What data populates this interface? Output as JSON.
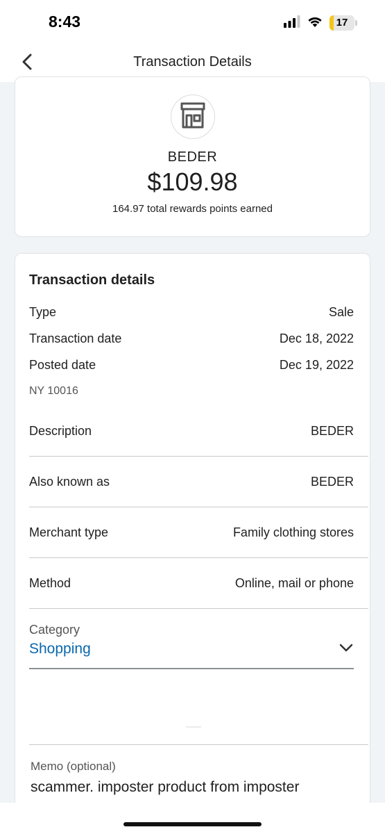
{
  "status_bar": {
    "time": "8:43",
    "battery_level": "17",
    "battery_fraction": 0.17,
    "battery_color": "#f5c518"
  },
  "nav": {
    "title": "Transaction Details",
    "back_icon": "chevron-left-icon"
  },
  "summary": {
    "merchant_icon": "storefront-icon",
    "merchant_name": "BEDER",
    "amount": "$109.98",
    "rewards": "164.97 total rewards points earned"
  },
  "details": {
    "title": "Transaction details",
    "type_label": "Type",
    "type_value": "Sale",
    "transaction_date_label": "Transaction date",
    "transaction_date_value": "Dec 18, 2022",
    "posted_date_label": "Posted date",
    "posted_date_value": "Dec 19, 2022",
    "location": "NY 10016",
    "description_label": "Description",
    "description_value": "BEDER",
    "aka_label": "Also known as",
    "aka_value": "BEDER",
    "merchant_type_label": "Merchant type",
    "merchant_type_value": "Family clothing stores",
    "method_label": "Method",
    "method_value": "Online, mail or phone"
  },
  "category": {
    "label": "Category",
    "value": "Shopping",
    "value_color": "#0a67ad",
    "chevron_icon": "chevron-down-icon"
  },
  "memo": {
    "label": "Memo (optional)",
    "value": "scammer.  imposter product from imposter"
  }
}
